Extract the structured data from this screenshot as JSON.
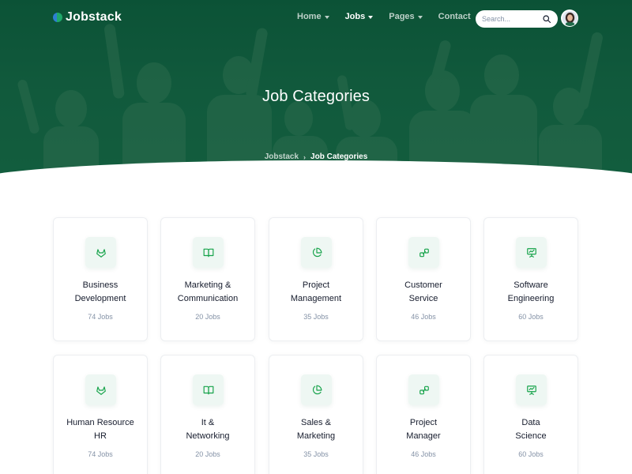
{
  "brand": {
    "name": "Jobstack"
  },
  "nav": {
    "items": [
      {
        "label": "Home",
        "dropdown": true,
        "active": false
      },
      {
        "label": "Jobs",
        "dropdown": true,
        "active": true
      },
      {
        "label": "Pages",
        "dropdown": true,
        "active": false
      },
      {
        "label": "Contact",
        "dropdown": false,
        "active": false
      }
    ]
  },
  "search": {
    "placeholder": "Search...",
    "value": ""
  },
  "hero": {
    "title": "Job Categories",
    "breadcrumb": {
      "home": "Jobstack",
      "separator": "›",
      "current": "Job Categories"
    }
  },
  "categories": [
    {
      "title_line1": "Business",
      "title_line2": "Development",
      "count": "74 Jobs",
      "icon": "gitlab-icon"
    },
    {
      "title_line1": "Marketing &",
      "title_line2": "Communication",
      "count": "20 Jobs",
      "icon": "book-open-icon"
    },
    {
      "title_line1": "Project",
      "title_line2": "Management",
      "count": "35 Jobs",
      "icon": "pie-chart-icon"
    },
    {
      "title_line1": "Customer",
      "title_line2": "Service",
      "count": "46 Jobs",
      "icon": "link-icon"
    },
    {
      "title_line1": "Software",
      "title_line2": "Engineering",
      "count": "60 Jobs",
      "icon": "presentation-icon"
    },
    {
      "title_line1": "Human Resource",
      "title_line2": "HR",
      "count": "74 Jobs",
      "icon": "gitlab-icon"
    },
    {
      "title_line1": "It &",
      "title_line2": "Networking",
      "count": "20 Jobs",
      "icon": "book-open-icon"
    },
    {
      "title_line1": "Sales &",
      "title_line2": "Marketing",
      "count": "35 Jobs",
      "icon": "pie-chart-icon"
    },
    {
      "title_line1": "Project",
      "title_line2": "Manager",
      "count": "46 Jobs",
      "icon": "link-icon"
    },
    {
      "title_line1": "Data",
      "title_line2": "Science",
      "count": "60 Jobs",
      "icon": "presentation-icon"
    }
  ],
  "colors": {
    "primary": "#0f5a3b",
    "accent": "#16a34a",
    "icon_bg": "#eef7f3",
    "muted": "#8492a6"
  }
}
